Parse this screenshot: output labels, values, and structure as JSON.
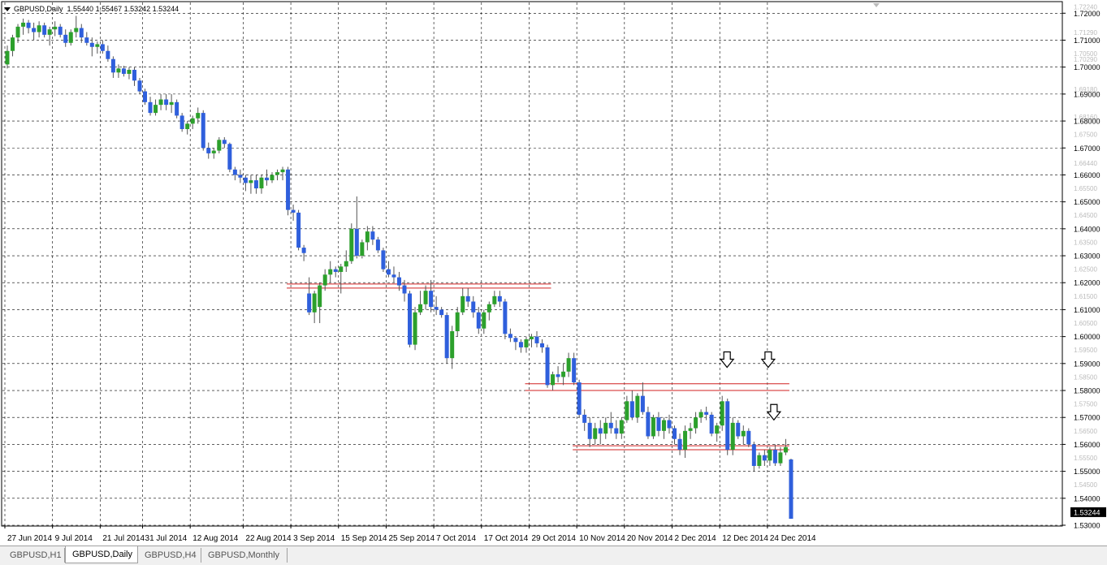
{
  "symbol_header": {
    "label": "GBPUSD,Daily",
    "ohlc": "1.55440 1.55467 1.53242 1.53244"
  },
  "tabs": [
    {
      "label": "GBPUSD,H1",
      "active": false
    },
    {
      "label": "GBPUSD,Daily",
      "active": true
    },
    {
      "label": "GBPUSD,H4",
      "active": false
    },
    {
      "label": "GBPUSD,Monthly",
      "active": false
    }
  ],
  "colors": {
    "bull": "#2ca02c",
    "bear": "#2f5fdc",
    "wick": "#555555",
    "grid": "#000000",
    "level_line": "#d02020",
    "price_badge": "#000000"
  },
  "chart_data": {
    "type": "candlestick",
    "ylim": [
      1.53,
      1.724
    ],
    "y_ticks": [
      "1.72000",
      "1.71000",
      "1.70000",
      "1.69000",
      "1.68000",
      "1.67000",
      "1.66000",
      "1.65000",
      "1.64000",
      "1.63000",
      "1.62000",
      "1.61000",
      "1.60000",
      "1.59000",
      "1.58000",
      "1.57000",
      "1.56000",
      "1.55000",
      "1.54000",
      "1.53000"
    ],
    "y_minor_ticks": [
      "1.72240",
      "1.71290",
      "1.70500",
      "1.70290",
      "1.69180",
      "1.68160",
      "1.67500",
      "1.66440",
      "1.65500",
      "1.64500",
      "1.63500",
      "1.62500",
      "1.61500",
      "1.60500",
      "1.59500",
      "1.58500",
      "1.57500",
      "1.56500",
      "1.55500",
      "1.54500",
      "1.53500"
    ],
    "x_labels": [
      "27 Jun 2014",
      "9 Jul 2014",
      "21 Jul 2014",
      "31 Jul 2014",
      "12 Aug 2014",
      "22 Aug 2014",
      "3 Sep 2014",
      "15 Sep 2014",
      "25 Sep 2014",
      "7 Oct 2014",
      "17 Oct 2014",
      "29 Oct 2014",
      "10 Nov 2014",
      "20 Nov 2014",
      "2 Dec 2014",
      "12 Dec 2014",
      "24 Dec 2014"
    ],
    "grid": true,
    "current_price": "1.53244",
    "levels": [
      {
        "price_top": 1.6195,
        "price_bottom": 1.618,
        "from_label": "3 Sep 2014",
        "to_label": "29 Oct 2014"
      },
      {
        "price_top": 1.5825,
        "price_bottom": 1.58,
        "from_label": "29 Oct 2014",
        "to_label": "24 Dec 2014"
      },
      {
        "price_top": 1.5595,
        "price_bottom": 1.558,
        "from_label": "10 Nov 2014",
        "to_label": "24 Dec 2014"
      }
    ],
    "arrows": [
      {
        "near_label": "12 Dec 2014",
        "price": 1.591
      },
      {
        "near_label": "24 Dec 2014",
        "price": 1.591
      },
      {
        "near_label": "24 Dec 2014",
        "price": 1.5715
      }
    ],
    "candles": [
      {
        "o": 1.701,
        "h": 1.708,
        "l": 1.6995,
        "c": 1.706
      },
      {
        "o": 1.706,
        "h": 1.712,
        "l": 1.704,
        "c": 1.711
      },
      {
        "o": 1.711,
        "h": 1.716,
        "l": 1.709,
        "c": 1.715
      },
      {
        "o": 1.715,
        "h": 1.718,
        "l": 1.712,
        "c": 1.7165
      },
      {
        "o": 1.7165,
        "h": 1.7175,
        "l": 1.7125,
        "c": 1.7145
      },
      {
        "o": 1.7145,
        "h": 1.7165,
        "l": 1.71,
        "c": 1.713
      },
      {
        "o": 1.713,
        "h": 1.717,
        "l": 1.711,
        "c": 1.7155
      },
      {
        "o": 1.7155,
        "h": 1.7165,
        "l": 1.711,
        "c": 1.712
      },
      {
        "o": 1.712,
        "h": 1.715,
        "l": 1.708,
        "c": 1.714
      },
      {
        "o": 1.714,
        "h": 1.717,
        "l": 1.7115,
        "c": 1.715
      },
      {
        "o": 1.715,
        "h": 1.716,
        "l": 1.711,
        "c": 1.712
      },
      {
        "o": 1.712,
        "h": 1.714,
        "l": 1.7075,
        "c": 1.709
      },
      {
        "o": 1.709,
        "h": 1.714,
        "l": 1.708,
        "c": 1.713
      },
      {
        "o": 1.713,
        "h": 1.719,
        "l": 1.711,
        "c": 1.7145
      },
      {
        "o": 1.7145,
        "h": 1.716,
        "l": 1.709,
        "c": 1.711
      },
      {
        "o": 1.711,
        "h": 1.713,
        "l": 1.708,
        "c": 1.709
      },
      {
        "o": 1.709,
        "h": 1.711,
        "l": 1.704,
        "c": 1.7075
      },
      {
        "o": 1.7075,
        "h": 1.7095,
        "l": 1.705,
        "c": 1.7085
      },
      {
        "o": 1.7085,
        "h": 1.71,
        "l": 1.705,
        "c": 1.706
      },
      {
        "o": 1.706,
        "h": 1.708,
        "l": 1.702,
        "c": 1.703
      },
      {
        "o": 1.703,
        "h": 1.704,
        "l": 1.696,
        "c": 1.698
      },
      {
        "o": 1.698,
        "h": 1.701,
        "l": 1.696,
        "c": 1.6995
      },
      {
        "o": 1.6995,
        "h": 1.7005,
        "l": 1.6965,
        "c": 1.6975
      },
      {
        "o": 1.6975,
        "h": 1.7,
        "l": 1.6955,
        "c": 1.699
      },
      {
        "o": 1.699,
        "h": 1.7,
        "l": 1.693,
        "c": 1.695
      },
      {
        "o": 1.695,
        "h": 1.696,
        "l": 1.69,
        "c": 1.691
      },
      {
        "o": 1.691,
        "h": 1.692,
        "l": 1.686,
        "c": 1.687
      },
      {
        "o": 1.687,
        "h": 1.689,
        "l": 1.682,
        "c": 1.683
      },
      {
        "o": 1.683,
        "h": 1.688,
        "l": 1.682,
        "c": 1.686
      },
      {
        "o": 1.686,
        "h": 1.69,
        "l": 1.684,
        "c": 1.688
      },
      {
        "o": 1.688,
        "h": 1.69,
        "l": 1.684,
        "c": 1.686
      },
      {
        "o": 1.686,
        "h": 1.69,
        "l": 1.683,
        "c": 1.687
      },
      {
        "o": 1.687,
        "h": 1.688,
        "l": 1.681,
        "c": 1.682
      },
      {
        "o": 1.682,
        "h": 1.683,
        "l": 1.676,
        "c": 1.677
      },
      {
        "o": 1.677,
        "h": 1.68,
        "l": 1.675,
        "c": 1.679
      },
      {
        "o": 1.679,
        "h": 1.682,
        "l": 1.677,
        "c": 1.681
      },
      {
        "o": 1.681,
        "h": 1.685,
        "l": 1.679,
        "c": 1.683
      },
      {
        "o": 1.683,
        "h": 1.684,
        "l": 1.669,
        "c": 1.67
      },
      {
        "o": 1.67,
        "h": 1.672,
        "l": 1.666,
        "c": 1.668
      },
      {
        "o": 1.668,
        "h": 1.67,
        "l": 1.666,
        "c": 1.669
      },
      {
        "o": 1.669,
        "h": 1.674,
        "l": 1.668,
        "c": 1.673
      },
      {
        "o": 1.673,
        "h": 1.674,
        "l": 1.67,
        "c": 1.6715
      },
      {
        "o": 1.6715,
        "h": 1.672,
        "l": 1.661,
        "c": 1.662
      },
      {
        "o": 1.662,
        "h": 1.663,
        "l": 1.658,
        "c": 1.66
      },
      {
        "o": 1.66,
        "h": 1.662,
        "l": 1.657,
        "c": 1.659
      },
      {
        "o": 1.659,
        "h": 1.66,
        "l": 1.654,
        "c": 1.657
      },
      {
        "o": 1.657,
        "h": 1.66,
        "l": 1.653,
        "c": 1.658
      },
      {
        "o": 1.658,
        "h": 1.66,
        "l": 1.653,
        "c": 1.655
      },
      {
        "o": 1.655,
        "h": 1.66,
        "l": 1.653,
        "c": 1.659
      },
      {
        "o": 1.659,
        "h": 1.662,
        "l": 1.656,
        "c": 1.658
      },
      {
        "o": 1.658,
        "h": 1.661,
        "l": 1.657,
        "c": 1.66
      },
      {
        "o": 1.66,
        "h": 1.662,
        "l": 1.658,
        "c": 1.661
      },
      {
        "o": 1.661,
        "h": 1.663,
        "l": 1.658,
        "c": 1.662
      },
      {
        "o": 1.662,
        "h": 1.663,
        "l": 1.645,
        "c": 1.647
      },
      {
        "o": 1.647,
        "h": 1.649,
        "l": 1.643,
        "c": 1.646
      },
      {
        "o": 1.646,
        "h": 1.647,
        "l": 1.632,
        "c": 1.633
      },
      {
        "o": 1.633,
        "h": 1.634,
        "l": 1.628,
        "c": 1.631
      },
      {
        "o": 1.616,
        "h": 1.622,
        "l": 1.608,
        "c": 1.609
      },
      {
        "o": 1.609,
        "h": 1.617,
        "l": 1.605,
        "c": 1.616
      },
      {
        "o": 1.611,
        "h": 1.62,
        "l": 1.605,
        "c": 1.619
      },
      {
        "o": 1.619,
        "h": 1.625,
        "l": 1.617,
        "c": 1.623
      },
      {
        "o": 1.623,
        "h": 1.628,
        "l": 1.62,
        "c": 1.625
      },
      {
        "o": 1.625,
        "h": 1.626,
        "l": 1.622,
        "c": 1.624
      },
      {
        "o": 1.624,
        "h": 1.627,
        "l": 1.616,
        "c": 1.626
      },
      {
        "o": 1.626,
        "h": 1.632,
        "l": 1.624,
        "c": 1.628
      },
      {
        "o": 1.628,
        "h": 1.642,
        "l": 1.627,
        "c": 1.64
      },
      {
        "o": 1.64,
        "h": 1.652,
        "l": 1.629,
        "c": 1.63
      },
      {
        "o": 1.63,
        "h": 1.636,
        "l": 1.629,
        "c": 1.635
      },
      {
        "o": 1.635,
        "h": 1.641,
        "l": 1.632,
        "c": 1.639
      },
      {
        "o": 1.639,
        "h": 1.641,
        "l": 1.634,
        "c": 1.636
      },
      {
        "o": 1.636,
        "h": 1.637,
        "l": 1.631,
        "c": 1.632
      },
      {
        "o": 1.632,
        "h": 1.633,
        "l": 1.624,
        "c": 1.625
      },
      {
        "o": 1.625,
        "h": 1.628,
        "l": 1.622,
        "c": 1.623
      },
      {
        "o": 1.623,
        "h": 1.626,
        "l": 1.62,
        "c": 1.622
      },
      {
        "o": 1.622,
        "h": 1.624,
        "l": 1.617,
        "c": 1.619
      },
      {
        "o": 1.619,
        "h": 1.621,
        "l": 1.613,
        "c": 1.616
      },
      {
        "o": 1.616,
        "h": 1.617,
        "l": 1.596,
        "c": 1.597
      },
      {
        "o": 1.597,
        "h": 1.611,
        "l": 1.595,
        "c": 1.609
      },
      {
        "o": 1.609,
        "h": 1.617,
        "l": 1.608,
        "c": 1.612
      },
      {
        "o": 1.612,
        "h": 1.619,
        "l": 1.61,
        "c": 1.617
      },
      {
        "o": 1.617,
        "h": 1.621,
        "l": 1.609,
        "c": 1.611
      },
      {
        "o": 1.611,
        "h": 1.615,
        "l": 1.608,
        "c": 1.61
      },
      {
        "o": 1.61,
        "h": 1.611,
        "l": 1.607,
        "c": 1.608
      },
      {
        "o": 1.608,
        "h": 1.609,
        "l": 1.59,
        "c": 1.592
      },
      {
        "o": 1.592,
        "h": 1.604,
        "l": 1.588,
        "c": 1.602
      },
      {
        "o": 1.602,
        "h": 1.611,
        "l": 1.6,
        "c": 1.609
      },
      {
        "o": 1.609,
        "h": 1.618,
        "l": 1.608,
        "c": 1.615
      },
      {
        "o": 1.615,
        "h": 1.618,
        "l": 1.611,
        "c": 1.613
      },
      {
        "o": 1.613,
        "h": 1.615,
        "l": 1.607,
        "c": 1.609
      },
      {
        "o": 1.609,
        "h": 1.611,
        "l": 1.601,
        "c": 1.603
      },
      {
        "o": 1.603,
        "h": 1.61,
        "l": 1.601,
        "c": 1.609
      },
      {
        "o": 1.609,
        "h": 1.613,
        "l": 1.606,
        "c": 1.612
      },
      {
        "o": 1.612,
        "h": 1.617,
        "l": 1.611,
        "c": 1.615
      },
      {
        "o": 1.615,
        "h": 1.617,
        "l": 1.611,
        "c": 1.613
      },
      {
        "o": 1.613,
        "h": 1.614,
        "l": 1.599,
        "c": 1.601
      },
      {
        "o": 1.601,
        "h": 1.603,
        "l": 1.598,
        "c": 1.5995
      },
      {
        "o": 1.5995,
        "h": 1.6,
        "l": 1.595,
        "c": 1.598
      },
      {
        "o": 1.598,
        "h": 1.599,
        "l": 1.594,
        "c": 1.596
      },
      {
        "o": 1.596,
        "h": 1.6,
        "l": 1.594,
        "c": 1.599
      },
      {
        "o": 1.599,
        "h": 1.601,
        "l": 1.596,
        "c": 1.6
      },
      {
        "o": 1.6,
        "h": 1.602,
        "l": 1.596,
        "c": 1.5975
      },
      {
        "o": 1.5975,
        "h": 1.599,
        "l": 1.594,
        "c": 1.596
      },
      {
        "o": 1.596,
        "h": 1.597,
        "l": 1.581,
        "c": 1.582
      },
      {
        "o": 1.582,
        "h": 1.587,
        "l": 1.58,
        "c": 1.586
      },
      {
        "o": 1.586,
        "h": 1.589,
        "l": 1.583,
        "c": 1.585
      },
      {
        "o": 1.585,
        "h": 1.59,
        "l": 1.582,
        "c": 1.587
      },
      {
        "o": 1.587,
        "h": 1.594,
        "l": 1.585,
        "c": 1.592
      },
      {
        "o": 1.592,
        "h": 1.594,
        "l": 1.582,
        "c": 1.583
      },
      {
        "o": 1.583,
        "h": 1.584,
        "l": 1.57,
        "c": 1.571
      },
      {
        "o": 1.571,
        "h": 1.573,
        "l": 1.565,
        "c": 1.568
      },
      {
        "o": 1.568,
        "h": 1.57,
        "l": 1.559,
        "c": 1.562
      },
      {
        "o": 1.562,
        "h": 1.568,
        "l": 1.56,
        "c": 1.566
      },
      {
        "o": 1.566,
        "h": 1.569,
        "l": 1.56,
        "c": 1.564
      },
      {
        "o": 1.564,
        "h": 1.57,
        "l": 1.562,
        "c": 1.568
      },
      {
        "o": 1.568,
        "h": 1.572,
        "l": 1.564,
        "c": 1.566
      },
      {
        "o": 1.566,
        "h": 1.569,
        "l": 1.562,
        "c": 1.564
      },
      {
        "o": 1.564,
        "h": 1.57,
        "l": 1.562,
        "c": 1.569
      },
      {
        "o": 1.569,
        "h": 1.578,
        "l": 1.568,
        "c": 1.576
      },
      {
        "o": 1.576,
        "h": 1.58,
        "l": 1.569,
        "c": 1.57
      },
      {
        "o": 1.57,
        "h": 1.579,
        "l": 1.568,
        "c": 1.578
      },
      {
        "o": 1.578,
        "h": 1.583,
        "l": 1.571,
        "c": 1.572
      },
      {
        "o": 1.572,
        "h": 1.574,
        "l": 1.562,
        "c": 1.563
      },
      {
        "o": 1.563,
        "h": 1.571,
        "l": 1.562,
        "c": 1.57
      },
      {
        "o": 1.57,
        "h": 1.572,
        "l": 1.563,
        "c": 1.565
      },
      {
        "o": 1.565,
        "h": 1.57,
        "l": 1.562,
        "c": 1.569
      },
      {
        "o": 1.569,
        "h": 1.571,
        "l": 1.564,
        "c": 1.566
      },
      {
        "o": 1.566,
        "h": 1.567,
        "l": 1.56,
        "c": 1.562
      },
      {
        "o": 1.562,
        "h": 1.564,
        "l": 1.556,
        "c": 1.558
      },
      {
        "o": 1.558,
        "h": 1.567,
        "l": 1.555,
        "c": 1.565
      },
      {
        "o": 1.565,
        "h": 1.568,
        "l": 1.562,
        "c": 1.566
      },
      {
        "o": 1.566,
        "h": 1.572,
        "l": 1.564,
        "c": 1.57
      },
      {
        "o": 1.57,
        "h": 1.573,
        "l": 1.568,
        "c": 1.572
      },
      {
        "o": 1.572,
        "h": 1.574,
        "l": 1.569,
        "c": 1.571
      },
      {
        "o": 1.571,
        "h": 1.572,
        "l": 1.563,
        "c": 1.564
      },
      {
        "o": 1.564,
        "h": 1.568,
        "l": 1.561,
        "c": 1.567
      },
      {
        "o": 1.567,
        "h": 1.578,
        "l": 1.565,
        "c": 1.576
      },
      {
        "o": 1.576,
        "h": 1.577,
        "l": 1.556,
        "c": 1.558
      },
      {
        "o": 1.558,
        "h": 1.57,
        "l": 1.556,
        "c": 1.568
      },
      {
        "o": 1.568,
        "h": 1.569,
        "l": 1.562,
        "c": 1.563
      },
      {
        "o": 1.563,
        "h": 1.567,
        "l": 1.56,
        "c": 1.565
      },
      {
        "o": 1.565,
        "h": 1.566,
        "l": 1.559,
        "c": 1.56
      },
      {
        "o": 1.56,
        "h": 1.561,
        "l": 1.55,
        "c": 1.552
      },
      {
        "o": 1.552,
        "h": 1.557,
        "l": 1.551,
        "c": 1.556
      },
      {
        "o": 1.556,
        "h": 1.558,
        "l": 1.552,
        "c": 1.554
      },
      {
        "o": 1.554,
        "h": 1.559,
        "l": 1.552,
        "c": 1.558
      },
      {
        "o": 1.558,
        "h": 1.56,
        "l": 1.552,
        "c": 1.553
      },
      {
        "o": 1.553,
        "h": 1.559,
        "l": 1.552,
        "c": 1.557
      },
      {
        "o": 1.557,
        "h": 1.562,
        "l": 1.556,
        "c": 1.559
      },
      {
        "o": 1.5544,
        "h": 1.5547,
        "l": 1.5324,
        "c": 1.5324
      }
    ]
  }
}
